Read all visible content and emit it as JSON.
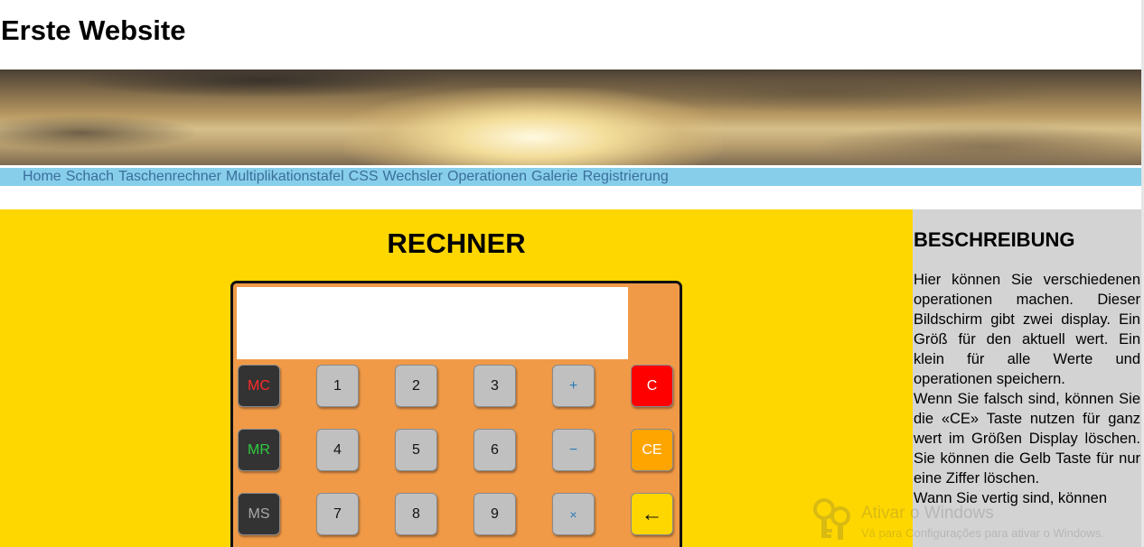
{
  "site": {
    "title": "Erste Website"
  },
  "nav": {
    "items": [
      "Home",
      "Schach",
      "Taschenrechner",
      "Multiplikationstafel",
      "CSS",
      "Wechsler",
      "Operationen",
      "Galerie",
      "Registrierung"
    ]
  },
  "main": {
    "heading": "RECHNER",
    "display_value": "",
    "keys": {
      "mc": "MC",
      "mr": "MR",
      "ms": "MS",
      "d1": "1",
      "d2": "2",
      "d3": "3",
      "d4": "4",
      "d5": "5",
      "d6": "6",
      "d7": "7",
      "d8": "8",
      "d9": "9",
      "plus": "+",
      "minus": "−",
      "times": "×",
      "clear": "C",
      "clear_entry": "CE",
      "backspace": "←"
    }
  },
  "sidebar": {
    "heading": "BESCHREIBUNG",
    "p1": "Hier können Sie verschiedenen operationen machen. Dieser Bildschirm gibt zwei display. Ein Größ für den aktuell wert. Ein klein für alle Werte und operationen speichern.",
    "p2": "Wenn Sie falsch sind, können Sie die «CE» Taste nutzen für ganz wert im Größen Display löschen. Sie können die Gelb Taste für nur eine Ziffer löschen.",
    "p3": "Wann Sie vertig sind, können"
  },
  "watermark": {
    "line1": "Ativar o Windows",
    "line2": "Vá para Configurações para ativar o Windows."
  },
  "colors": {
    "nav_bg": "#87ceeb",
    "main_bg": "#ffd700",
    "calc_bg": "#f09a48",
    "sidebar_bg": "#d3d3d3",
    "key_clear": "#ff0000",
    "key_clear_entry": "#ffa500",
    "key_backspace": "#ffd700",
    "key_mc_text": "#ff2a2a",
    "key_mr_text": "#2ecc40",
    "key_ms_text": "#aaaaaa"
  }
}
